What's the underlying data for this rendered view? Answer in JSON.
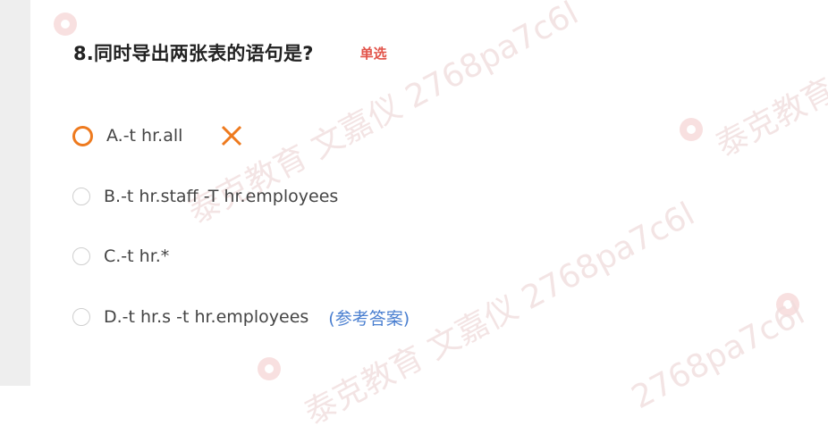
{
  "question": {
    "title": "8.同时导出两张表的语句是?",
    "type_badge": "单选"
  },
  "options": [
    {
      "label": "A.-t hr.all",
      "state": "selected-wrong"
    },
    {
      "label": "B.-t hr.staff -T hr.employees",
      "state": "unselected"
    },
    {
      "label": "C.-t hr.*",
      "state": "unselected"
    },
    {
      "label": "D.-t hr.s -t hr.employees",
      "state": "unselected",
      "reference": "(参考答案)"
    }
  ],
  "watermark": {
    "org": "泰克教育",
    "line": "泰克教育 文嘉仪 2768pa7c6l",
    "short": "2768pa7c6l"
  },
  "colors": {
    "title": "#222222",
    "badge": "#e2544a",
    "wrong": "#ee7a1e",
    "reference": "#4a7fd0",
    "option_text": "#444444"
  }
}
